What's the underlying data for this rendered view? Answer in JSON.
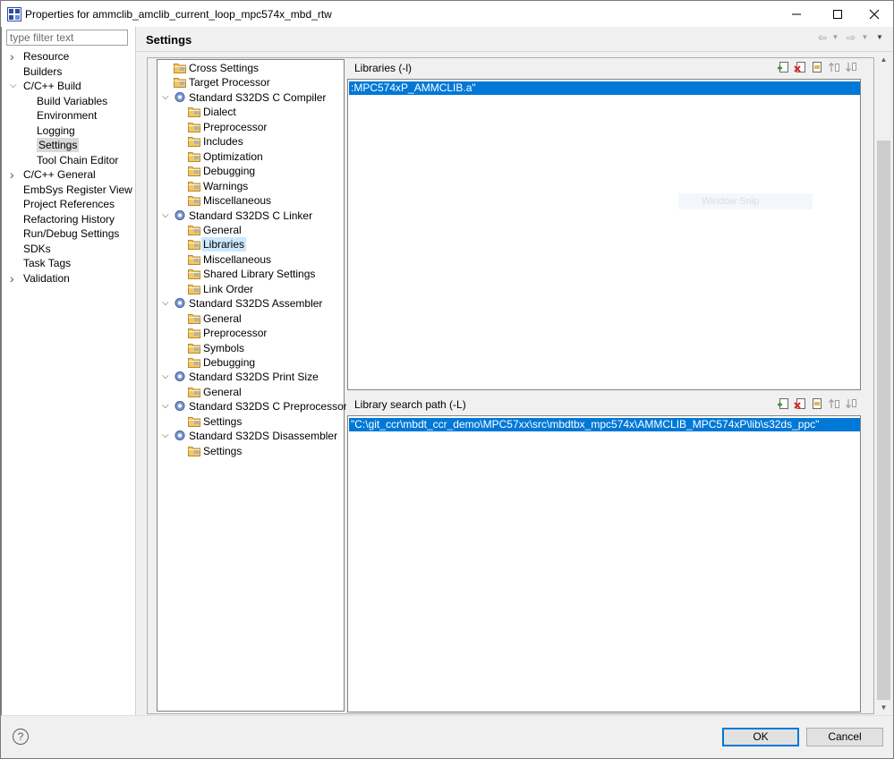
{
  "window": {
    "title": "Properties for ammclib_amclib_current_loop_mpc574x_mbd_rtw",
    "minimize_icon": "minimize-icon",
    "maximize_icon": "maximize-icon",
    "close_icon": "close-icon"
  },
  "filter": {
    "placeholder": "type filter text"
  },
  "left_nav": {
    "items": [
      {
        "label": "Resource",
        "expandable": true,
        "expanded": false
      },
      {
        "label": "Builders"
      },
      {
        "label": "C/C++ Build",
        "expandable": true,
        "expanded": true
      },
      {
        "label": "Build Variables",
        "child": true
      },
      {
        "label": "Environment",
        "child": true
      },
      {
        "label": "Logging",
        "child": true
      },
      {
        "label": "Settings",
        "child": true,
        "selected": true
      },
      {
        "label": "Tool Chain Editor",
        "child": true
      },
      {
        "label": "C/C++ General",
        "expandable": true,
        "expanded": false
      },
      {
        "label": "EmbSys Register View"
      },
      {
        "label": "Project References"
      },
      {
        "label": "Refactoring History"
      },
      {
        "label": "Run/Debug Settings"
      },
      {
        "label": "SDKs"
      },
      {
        "label": "Task Tags"
      },
      {
        "label": "Validation",
        "expandable": true,
        "expanded": false
      }
    ]
  },
  "page": {
    "title": "Settings"
  },
  "tool_tree": {
    "items": [
      {
        "label": "Cross Settings",
        "level": 0
      },
      {
        "label": "Target Processor",
        "level": 0
      },
      {
        "label": "Standard S32DS C Compiler",
        "level": 0,
        "tool": true
      },
      {
        "label": "Dialect",
        "level": 1
      },
      {
        "label": "Preprocessor",
        "level": 1
      },
      {
        "label": "Includes",
        "level": 1
      },
      {
        "label": "Optimization",
        "level": 1
      },
      {
        "label": "Debugging",
        "level": 1
      },
      {
        "label": "Warnings",
        "level": 1
      },
      {
        "label": "Miscellaneous",
        "level": 1
      },
      {
        "label": "Standard S32DS C Linker",
        "level": 0,
        "tool": true
      },
      {
        "label": "General",
        "level": 1
      },
      {
        "label": "Libraries",
        "level": 1,
        "selected": true
      },
      {
        "label": "Miscellaneous",
        "level": 1
      },
      {
        "label": "Shared Library Settings",
        "level": 1
      },
      {
        "label": "Link Order",
        "level": 1
      },
      {
        "label": "Standard S32DS Assembler",
        "level": 0,
        "tool": true
      },
      {
        "label": "General",
        "level": 1
      },
      {
        "label": "Preprocessor",
        "level": 1
      },
      {
        "label": "Symbols",
        "level": 1
      },
      {
        "label": "Debugging",
        "level": 1
      },
      {
        "label": "Standard S32DS Print Size",
        "level": 0,
        "tool": true
      },
      {
        "label": "General",
        "level": 1
      },
      {
        "label": "Standard S32DS C Preprocessor",
        "level": 0,
        "tool": true
      },
      {
        "label": "Settings",
        "level": 1
      },
      {
        "label": "Standard S32DS Disassembler",
        "level": 0,
        "tool": true
      },
      {
        "label": "Settings",
        "level": 1
      }
    ]
  },
  "libraries_panel": {
    "title": "Libraries (-l)",
    "items": [
      ":MPC574xP_AMMCLIB.a\""
    ],
    "toolbar": [
      "add-icon",
      "delete-icon",
      "edit-icon",
      "move-up-icon",
      "move-down-icon"
    ]
  },
  "search_path_panel": {
    "title": "Library search path (-L)",
    "items": [
      "\"C:\\git_ccr\\mbdt_ccr_demo\\MPC57xx\\src\\mbdtbx_mpc574x\\AMMCLIB_MPC574xP\\lib\\s32ds_ppc\""
    ],
    "toolbar": [
      "add-icon",
      "delete-icon",
      "edit-icon",
      "move-up-icon",
      "move-down-icon"
    ]
  },
  "overlay": {
    "watermark": "Window Snip"
  },
  "footer": {
    "help_label": "?",
    "ok_label": "OK",
    "cancel_label": "Cancel"
  }
}
